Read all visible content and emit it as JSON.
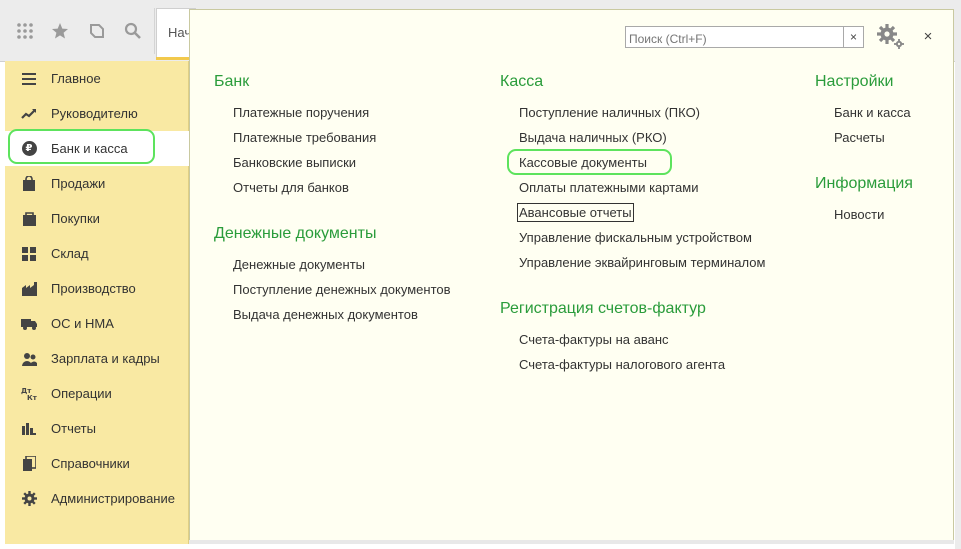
{
  "toolbar": {
    "icons": [
      "apps-grid-icon",
      "star-icon",
      "history-icon",
      "search-icon"
    ],
    "start_tab_label": "Начальная страница"
  },
  "sidebar": {
    "items": [
      {
        "label": "Главное",
        "icon": "menu-lines-icon"
      },
      {
        "label": "Руководителю",
        "icon": "trend-chart-icon"
      },
      {
        "label": "Банк и касса",
        "icon": "ruble-icon",
        "active": true
      },
      {
        "label": "Продажи",
        "icon": "shopping-bag-icon"
      },
      {
        "label": "Покупки",
        "icon": "cart-icon"
      },
      {
        "label": "Склад",
        "icon": "warehouse-grid-icon"
      },
      {
        "label": "Производство",
        "icon": "factory-icon"
      },
      {
        "label": "ОС и НМА",
        "icon": "truck-icon"
      },
      {
        "label": "Зарплата и кадры",
        "icon": "people-icon"
      },
      {
        "label": "Операции",
        "icon": "dt-kt-icon"
      },
      {
        "label": "Отчеты",
        "icon": "bar-chart-icon"
      },
      {
        "label": "Справочники",
        "icon": "books-icon"
      },
      {
        "label": "Администрирование",
        "icon": "gear-icon"
      }
    ]
  },
  "panel": {
    "search": {
      "placeholder": "Поиск (Ctrl+F)",
      "value": ""
    },
    "clear_label": "×",
    "close_label": "×",
    "sections": {
      "bank": {
        "title": "Банк",
        "links": [
          "Платежные поручения",
          "Платежные требования",
          "Банковские выписки",
          "Отчеты для банков"
        ]
      },
      "money_docs": {
        "title": "Денежные документы",
        "links": [
          "Денежные документы",
          "Поступление денежных документов",
          "Выдача денежных документов"
        ]
      },
      "cash": {
        "title": "Касса",
        "links": [
          "Поступление наличных (ПКО)",
          "Выдача наличных (РКО)",
          "Кассовые документы",
          "Оплаты платежными картами",
          "Авансовые отчеты",
          "Управление фискальным устройством",
          "Управление эквайринговым терминалом"
        ]
      },
      "invoices": {
        "title": "Регистрация счетов-фактур",
        "links": [
          "Счета-фактуры на аванс",
          "Счета-фактуры налогового агента"
        ]
      },
      "settings": {
        "title": "Настройки",
        "links": [
          "Банк и касса",
          "Расчеты"
        ]
      },
      "info": {
        "title": "Информация",
        "links": [
          "Новости"
        ]
      }
    }
  },
  "colors": {
    "section_title": "#2a9c3b",
    "sidebar_bg": "#f9e9a3",
    "panel_bg": "#fffff2",
    "highlight": "#5de35d"
  }
}
